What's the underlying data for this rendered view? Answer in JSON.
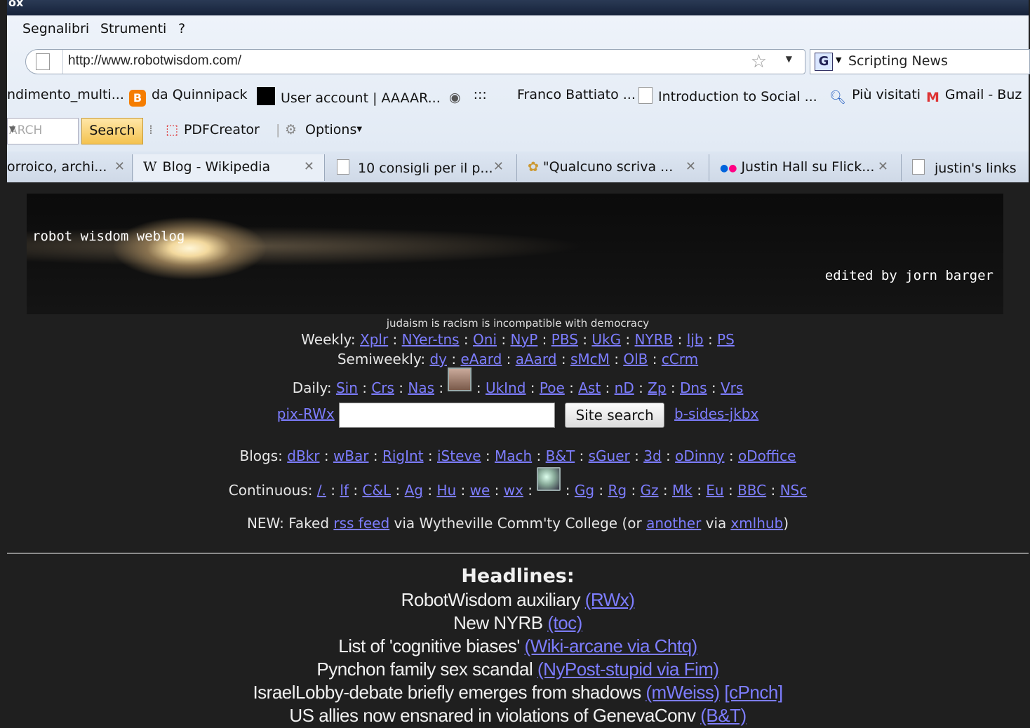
{
  "window": {
    "title_fragment": "ox"
  },
  "menu": {
    "items": [
      "Segnalibri",
      "Strumenti",
      "?"
    ]
  },
  "navbar": {
    "url": "http://www.robotwisdom.com/",
    "search_engine": "Scripting News"
  },
  "bookmarks": [
    {
      "label": "ndimento_multi...",
      "icon": "none"
    },
    {
      "label": "da Quinnipack",
      "icon": "blogger-icon"
    },
    {
      "label": "User account | AAAAR...",
      "icon": "black-square-icon"
    },
    {
      "label": ":::",
      "icon": "eye-icon"
    },
    {
      "label": "Franco Battiato ...",
      "icon": "none"
    },
    {
      "label": "Introduction to Social ...",
      "icon": "page-icon"
    },
    {
      "label": "Più visitati",
      "icon": "search-icon"
    },
    {
      "label": "Gmail - Buz",
      "icon": "gmail-icon"
    }
  ],
  "toolbar": {
    "search_field": "ARCH",
    "search_button": "Search",
    "pdf": "PDFCreator",
    "options": "Options"
  },
  "tabs": [
    {
      "label": "orroico, archi..."
    },
    {
      "label": "Blog - Wikipedia"
    },
    {
      "label": "10 consigli per il p..."
    },
    {
      "label": "\"Qualcuno scriva ..."
    },
    {
      "label": "Justin Hall su Flick..."
    },
    {
      "label": "justin's links"
    }
  ],
  "banner": {
    "title": "robot wisdom weblog",
    "editor": "edited by jorn barger"
  },
  "tagline": "judaism is racism is incompatible with democracy",
  "weekly": {
    "label": "Weekly:",
    "links": [
      "Xplr",
      "NYer-tns",
      "Oni",
      "NyP",
      "PBS",
      "UkG",
      "NYRB",
      "ljb",
      "PS"
    ]
  },
  "semiweekly": {
    "label": "Semiweekly:",
    "links": [
      "dy",
      "eAard",
      "aAard",
      "sMcM",
      "OlB",
      "cCrm"
    ]
  },
  "daily": {
    "label": "Daily:",
    "links_before": [
      "Sin",
      "Crs",
      "Nas"
    ],
    "links_after": [
      "UkInd",
      "Poe",
      "Ast",
      "nD",
      "Zp",
      "Dns",
      "Vrs"
    ]
  },
  "searchrow": {
    "left_link": "pix-RWx",
    "button": "Site search",
    "right_link": "b-sides-jkbx"
  },
  "blogs": {
    "label": "Blogs:",
    "links": [
      "dBkr",
      "wBar",
      "RigInt",
      "iSteve",
      "Mach",
      "B&T",
      "sGuer",
      "3d",
      "oDinny",
      "oDoffice"
    ]
  },
  "continuous": {
    "label": "Continuous:",
    "links_before": [
      "/.",
      "lf",
      "C&L",
      "Ag",
      "Hu",
      "we",
      "wx"
    ],
    "links_after": [
      "Gg",
      "Rg",
      "Gz",
      "Mk",
      "Eu",
      "BBC",
      "NSc"
    ]
  },
  "newline": {
    "prefix": "NEW: Faked",
    "link1": "rss feed",
    "mid": "via Wytheville Comm'ty College (or",
    "link2": "another",
    "mid2": "via",
    "link3": "xmlhub",
    "suffix": ")"
  },
  "headlines": {
    "title": "Headlines:",
    "items": [
      {
        "text": "RobotWisdom auxiliary",
        "link": "(RWx)"
      },
      {
        "text": "New NYRB",
        "link": "(toc)"
      },
      {
        "text": "List of 'cognitive biases'",
        "link": "(Wiki-arcane via Chtq)"
      },
      {
        "text": "Pynchon family sex scandal",
        "link": "(NyPost-stupid via Fim)"
      },
      {
        "text": "IsraelLobby-debate briefly emerges from shadows",
        "link": "(mWeiss)",
        "link2": "[cPnch]"
      },
      {
        "text": "US allies now ensnared in violations of GenevaConv",
        "link": "(B&T)"
      }
    ]
  }
}
